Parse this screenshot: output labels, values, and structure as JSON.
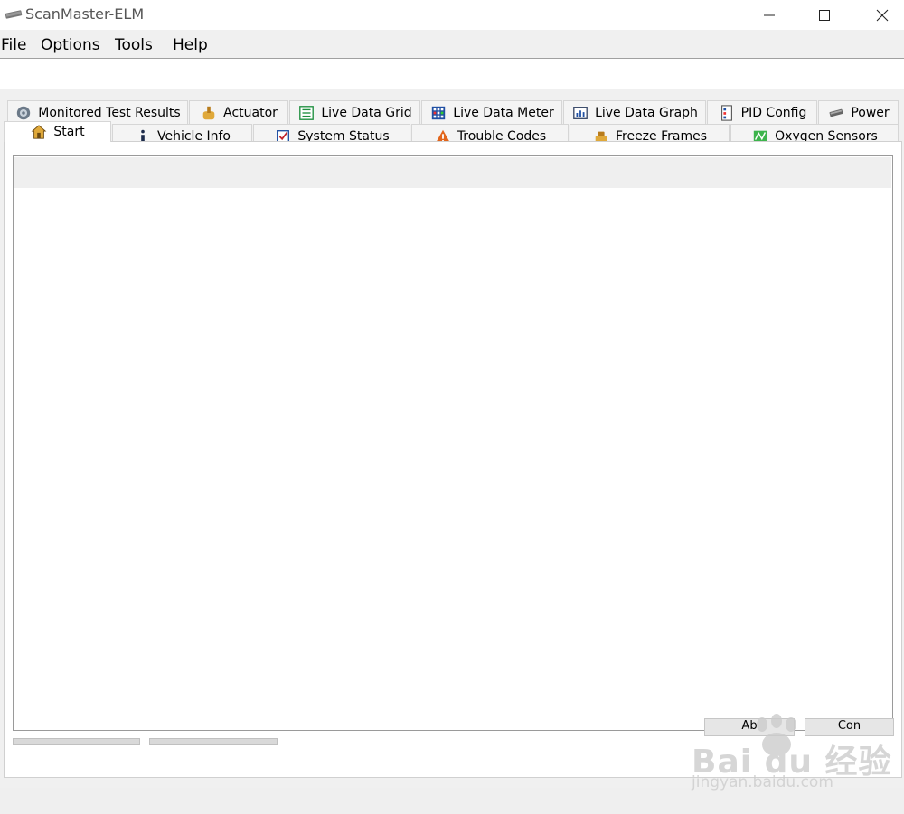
{
  "window": {
    "title": "ScanMaster-ELM",
    "icon": "chip-icon",
    "controls": [
      "minimize-icon",
      "maximize-icon",
      "close-icon"
    ]
  },
  "menu": [
    "File",
    "Options",
    "Tools",
    "Help"
  ],
  "tabs": {
    "row1": [
      {
        "label": "Monitored Test Results",
        "icon": "gear-icon"
      },
      {
        "label": "Actuator",
        "icon": "actuator-icon"
      },
      {
        "label": "Live Data Grid",
        "icon": "grid-icon"
      },
      {
        "label": "Live Data Meter",
        "icon": "meter-icon"
      },
      {
        "label": "Live Data Graph",
        "icon": "graph-icon"
      },
      {
        "label": "PID Config",
        "icon": "pid-config-icon"
      },
      {
        "label": "Power",
        "icon": "chip-icon"
      }
    ],
    "row2": [
      {
        "label": "Start",
        "icon": "home-icon",
        "selected": true
      },
      {
        "label": "Vehicle Info",
        "icon": "info-icon"
      },
      {
        "label": "System Status",
        "icon": "checklist-icon"
      },
      {
        "label": "Trouble Codes",
        "icon": "warning-icon"
      },
      {
        "label": "Freeze Frames",
        "icon": "freeze-icon"
      },
      {
        "label": "Oxygen Sensors",
        "icon": "oxygen-sensor-icon"
      }
    ]
  },
  "buttons": {
    "left_partial": "Ab",
    "right_partial": "Con"
  },
  "watermark": {
    "brand": "Bai du 经验",
    "url": "jingyan.baidu.com"
  },
  "colors": {
    "window_bg": "#f0f0f0",
    "titlebar_bg": "#ffffff",
    "content_header": "#efefef",
    "warning": "#e2651b",
    "grid_blue": "#1f4fa3",
    "list_green": "#1f8f3f"
  }
}
